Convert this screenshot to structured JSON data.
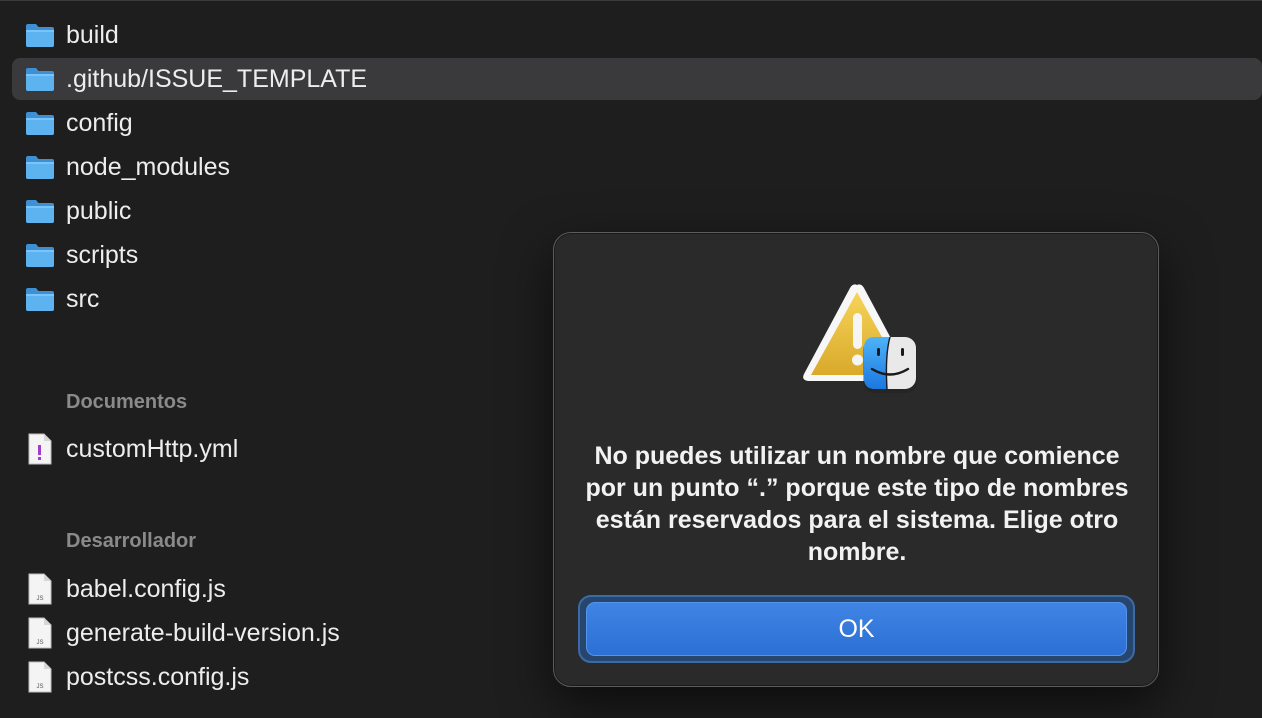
{
  "folders": [
    {
      "name": "build",
      "selected": false
    },
    {
      "name": ".github/ISSUE_TEMPLATE",
      "selected": true
    },
    {
      "name": "config",
      "selected": false
    },
    {
      "name": "node_modules",
      "selected": false
    },
    {
      "name": "public",
      "selected": false
    },
    {
      "name": "scripts",
      "selected": false
    },
    {
      "name": "src",
      "selected": false
    }
  ],
  "sections": {
    "documentos": {
      "title": "Documentos",
      "files": [
        {
          "name": "customHttp.yml",
          "icon": "yaml-file-icon"
        }
      ]
    },
    "desarrollador": {
      "title": "Desarrollador",
      "files": [
        {
          "name": "babel.config.js",
          "icon": "js-file-icon",
          "icon_label": "JS"
        },
        {
          "name": "generate-build-version.js",
          "icon": "js-file-icon",
          "icon_label": "JS"
        },
        {
          "name": "postcss.config.js",
          "icon": "js-file-icon",
          "icon_label": "JS"
        }
      ]
    }
  },
  "dialog": {
    "icon": "finder-warning-icon",
    "message": "No puedes utilizar un nombre que comience por un punto “.” porque este tipo de nombres están reservados para el sistema. Elige otro nombre.",
    "ok_label": "OK"
  },
  "colors": {
    "folder": "#4aa3e8",
    "selection": "#3a3a3c",
    "accent": "#2f74d8",
    "background": "#1e1e1e"
  }
}
